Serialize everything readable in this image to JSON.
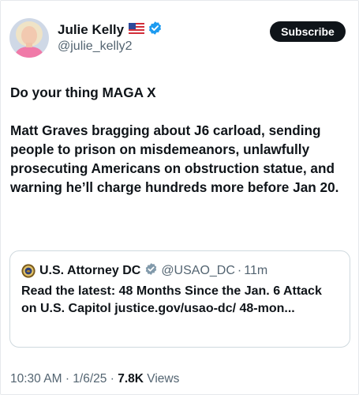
{
  "author": {
    "name": "Julie Kelly",
    "flag_emoji": "🇺🇸",
    "verified_icon": "verified-badge-blue",
    "handle": "@julie_kelly2",
    "avatar": "avatar-photo"
  },
  "subscribe_label": "Subscribe",
  "tweet": {
    "line1": "Do your thing MAGA X",
    "line2": "Matt Graves bragging about J6 carload, sending people to prison on misdemeanors, unlawfully prosecuting Americans on obstruction statue, and warning he’ll charge hundreds more before Jan 20."
  },
  "quote": {
    "seal_icon": "doj-seal-icon",
    "name": "U.S. Attorney DC",
    "verified_icon": "verified-badge-gray",
    "handle": "@USAO_DC",
    "separator": "·",
    "time": "11m",
    "text": "Read the latest: 48 Months Since the Jan. 6 Attack on U.S. Capitol justice.gov/usao-dc/ 48-mon..."
  },
  "meta": {
    "time": "10:30 AM",
    "sep1": "·",
    "date": "1/6/25",
    "sep2": "·",
    "views_count": "7.8K",
    "views_label": "Views"
  },
  "colors": {
    "text_primary": "#0f1419",
    "text_secondary": "#536471",
    "verified_blue": "#1d9bf0",
    "verified_gray": "#829aab",
    "border": "#cfd9de"
  }
}
